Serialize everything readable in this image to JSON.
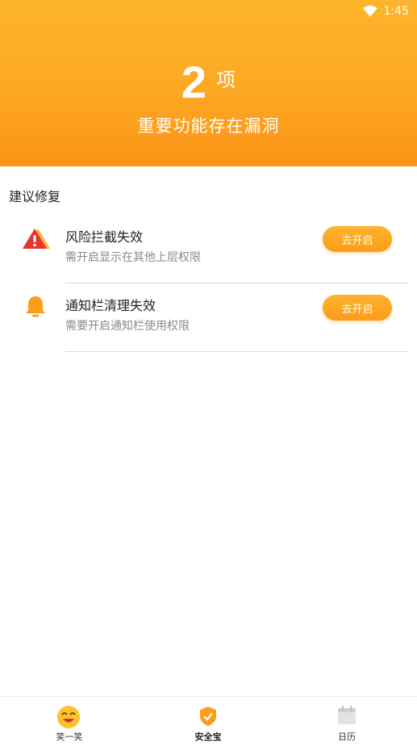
{
  "status_bar": {
    "time": "1:45",
    "icons": [
      "wifi-icon"
    ]
  },
  "header": {
    "count": "2",
    "unit": "项",
    "subtitle": "重要功能存在漏洞"
  },
  "section": {
    "title": "建议修复"
  },
  "items": [
    {
      "icon": "warning-icon",
      "title": "风险拦截失效",
      "desc": "需开启显示在其他上层权限",
      "button": "去开启"
    },
    {
      "icon": "bell-icon",
      "title": "通知栏清理失效",
      "desc": "需要开启通知栏使用权限",
      "button": "去开启"
    }
  ],
  "tabs": [
    {
      "icon": "smile-icon",
      "label": "笑一笑"
    },
    {
      "icon": "shield-icon",
      "label": "安全宝",
      "active": true
    },
    {
      "icon": "calendar-icon",
      "label": "日历"
    }
  ],
  "colors": {
    "accent": "#fda824",
    "accent_dark": "#fa9416",
    "warning": "#e8322f"
  }
}
